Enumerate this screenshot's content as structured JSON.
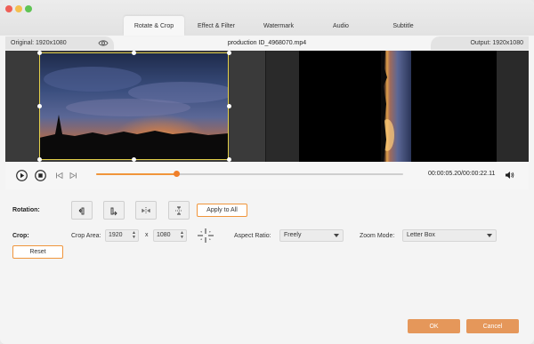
{
  "tabs": [
    {
      "label": "Rotate & Crop",
      "active": true
    },
    {
      "label": "Effect & Filter",
      "active": false
    },
    {
      "label": "Watermark",
      "active": false
    },
    {
      "label": "Audio",
      "active": false
    },
    {
      "label": "Subtitle",
      "active": false
    }
  ],
  "info": {
    "original": "Original: 1920x1080",
    "filename": "production ID_4968070.mp4",
    "output": "Output: 1920x1080"
  },
  "playback": {
    "time": "00:00:05.20/00:00:22.11",
    "progress_percent": 26
  },
  "rotation": {
    "label": "Rotation:",
    "buttons": [
      "rotate-left-icon",
      "rotate-right-icon",
      "flip-horizontal-icon",
      "flip-vertical-icon"
    ],
    "apply_all": "Apply to All"
  },
  "crop": {
    "label": "Crop:",
    "area_label": "Crop Area:",
    "width": "1920",
    "height": "1080",
    "times": "x",
    "aspect_label": "Aspect Ratio:",
    "aspect_value": "Freely",
    "zoom_label": "Zoom Mode:",
    "zoom_value": "Letter Box",
    "reset": "Reset"
  },
  "footer": {
    "ok": "OK",
    "cancel": "Cancel"
  },
  "colors": {
    "accent": "#f0953b",
    "button_fill": "#e5975a",
    "crop_frame": "#e3d04a"
  }
}
